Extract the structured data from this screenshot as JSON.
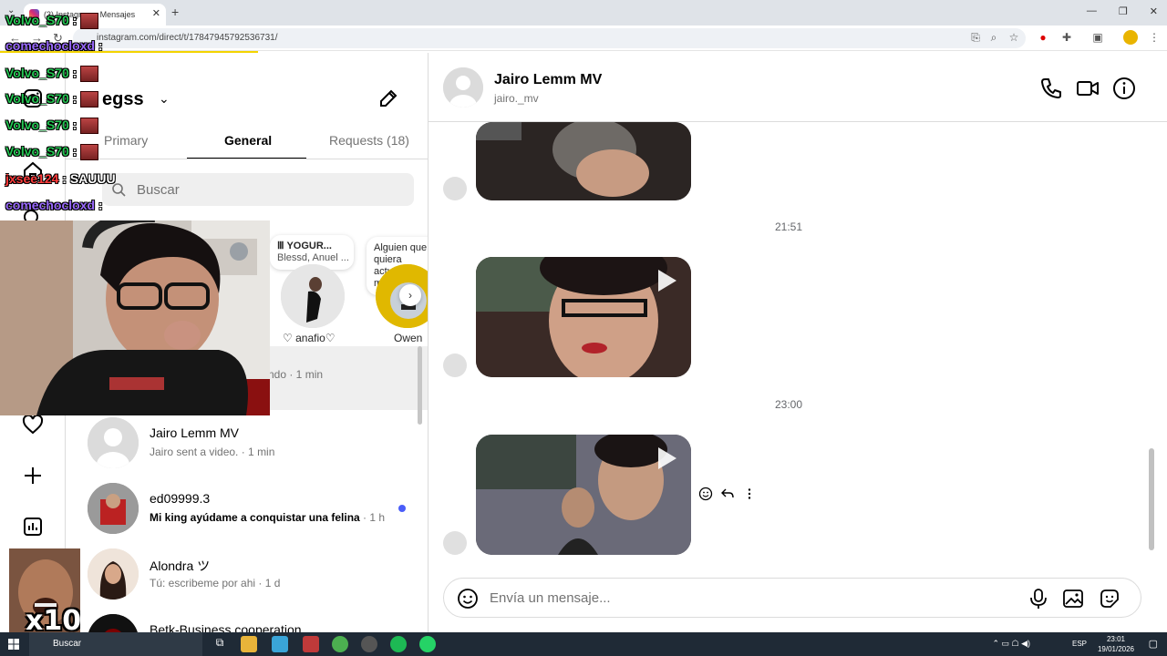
{
  "browser": {
    "tab_title": "(3) Instagram • Mensajes",
    "url": "instagram.com/direct/t/17847945792536731/"
  },
  "list": {
    "username": "egss",
    "tabs": [
      {
        "label": "Primary"
      },
      {
        "label": "General"
      },
      {
        "label": "Requests (18)"
      }
    ],
    "search_placeholder": "Buscar",
    "notes": [
      {
        "title": "YOGUR...",
        "subtitle": "Blessd, Anuel ...",
        "name": "♡ anafio♡"
      },
      {
        "text": "Alguien que quiera actuar de madre para",
        "name": "Owen"
      }
    ],
    "active_row_time": "ndo · 1 min",
    "conversations": [
      {
        "name": "Jairo Lemm MV",
        "preview": "Jairo sent a video.",
        "time": " · 1 min",
        "unread": false
      },
      {
        "name": "ed09999.3",
        "preview": "Mi king ayúdame a conquistar una felina",
        "time": " · 1 h",
        "unread": true
      },
      {
        "name": "Alondra ツ",
        "preview": "Tú: escribeme por ahi",
        "time": " · 1 d",
        "unread": false
      },
      {
        "name": "Betk-Business cooperation",
        "preview": "",
        "time": "",
        "unread": false
      }
    ]
  },
  "chat": {
    "name": "Jairo Lemm MV",
    "handle": "jairo._mv",
    "timestamps": [
      "21:51",
      "23:00"
    ],
    "composer_placeholder": "Envía un mensaje..."
  },
  "overlay": {
    "lines": [
      {
        "user": "Volvo_S70",
        "msg": ":",
        "color": "green"
      },
      {
        "user": "comechocloxd",
        "msg": ":",
        "color": "purple"
      },
      {
        "user": "Volvo_S70",
        "msg": ":",
        "color": "green"
      },
      {
        "user": "Volvo_S70",
        "msg": ":",
        "color": "green"
      },
      {
        "user": "Volvo_S70",
        "msg": ":",
        "color": "green"
      },
      {
        "user": "Volvo_S70",
        "msg": ":",
        "color": "green"
      },
      {
        "user": "jxsee124",
        "msg": ": SAUUU",
        "color": "red"
      },
      {
        "user": "comechocloxd",
        "msg": ":",
        "color": "purple"
      }
    ],
    "badge": "x10"
  },
  "taskbar": {
    "search": "Buscar",
    "lang": "ESP",
    "time": "23:01",
    "date": "19/01/2026"
  },
  "colors": {
    "accent": "#4a5df9",
    "overlay_green": "#23c552",
    "overlay_purple": "#9b6bff"
  }
}
